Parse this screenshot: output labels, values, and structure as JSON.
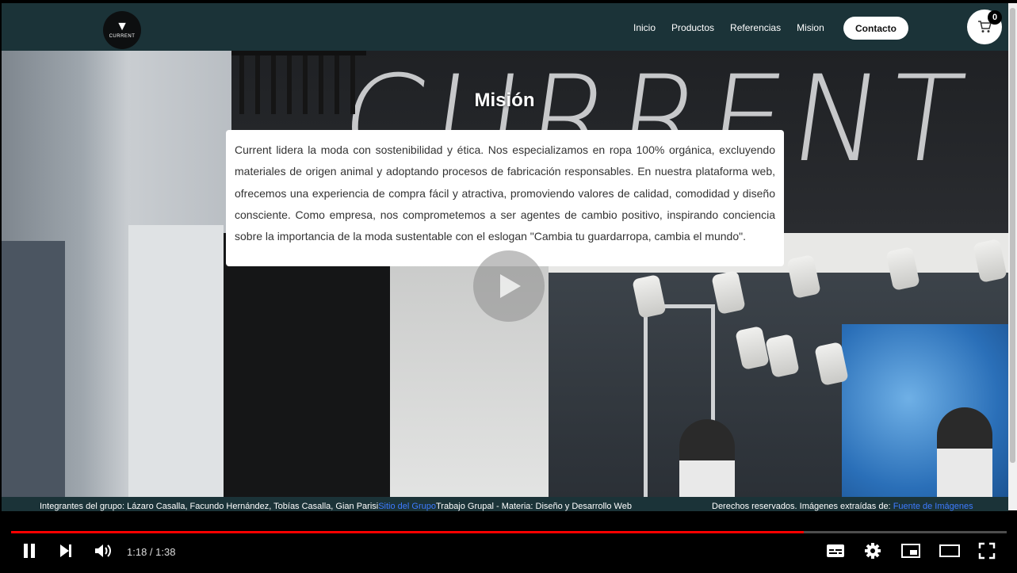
{
  "nav": {
    "logo_text": "CURRENT",
    "links": [
      "Inicio",
      "Productos",
      "Referencias",
      "Mision"
    ],
    "contact": "Contacto",
    "cart_count": "0"
  },
  "mission": {
    "title": "Misión",
    "text": "Current lidera la moda con sostenibilidad y ética. Nos especializamos en ropa 100% orgánica, excluyendo materiales de origen animal y adoptando procesos de fabricación responsables. En nuestra plataforma web, ofrecemos una experiencia de compra fácil y atractiva, promoviendo valores de calidad, comodidad y diseño consciente. Como empresa, nos comprometemos a ser agentes de cambio positivo, inspirando conciencia sobre la importancia de la moda sustentable con el eslogan \"Cambia tu guardarropa, cambia el mundo\"."
  },
  "background": {
    "sign_text": "CURRENT"
  },
  "footer": {
    "members": "Integrantes del grupo: Lázaro Casalla, Facundo Hernández, Tobías Casalla, Gian Parisi",
    "group_link": "Sitio del Grupo",
    "course": "Trabajo Grupal - Materia: Diseño y Desarrollo Web",
    "rights": "Derechos reservados. Imágenes extraídas de: ",
    "images_link": "Fuente de Imágenes"
  },
  "player": {
    "time": "1:18 / 1:38",
    "progress_fraction": 0.796
  },
  "icons": {
    "pause": "pause-icon",
    "next": "next-icon",
    "volume": "volume-icon",
    "subtitles": "subtitles-icon",
    "settings": "settings-icon",
    "miniplayer": "miniplayer-icon",
    "theater": "theater-icon",
    "fullscreen": "fullscreen-icon",
    "cart": "cart-icon",
    "play": "play-icon"
  },
  "colors": {
    "navbar": "#1b3338",
    "progress": "#ff0000",
    "link": "#3d7bff"
  }
}
